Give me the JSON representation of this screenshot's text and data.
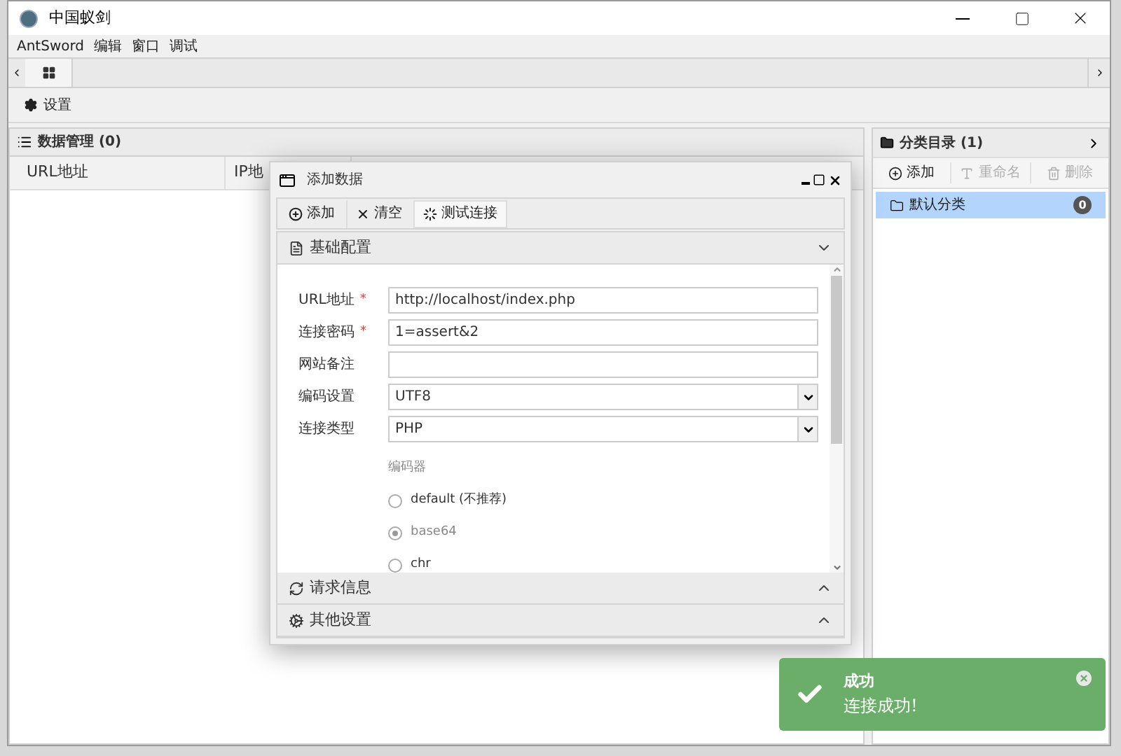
{
  "window": {
    "title": "中国蚁剑"
  },
  "menu": [
    "AntSword",
    "编辑",
    "窗口",
    "调试"
  ],
  "toolbar": {
    "settings": "设置"
  },
  "data_panel": {
    "title": "数据管理 (0)",
    "columns": [
      "URL地址",
      "IP地"
    ]
  },
  "category_panel": {
    "title": "分类目录 (1)",
    "buttons": [
      {
        "label": "添加",
        "disabled": false
      },
      {
        "label": "重命名",
        "disabled": true
      },
      {
        "label": "删除",
        "disabled": true
      }
    ],
    "items": [
      {
        "label": "默认分类",
        "count": "0",
        "selected": true
      }
    ]
  },
  "dialog": {
    "title": "添加数据",
    "buttons": [
      {
        "label": "添加",
        "selected": false
      },
      {
        "label": "清空",
        "selected": false
      },
      {
        "label": "测试连接",
        "selected": true
      }
    ],
    "sections": [
      {
        "title": "基础配置",
        "expanded": true
      },
      {
        "title": "请求信息",
        "expanded": false
      },
      {
        "title": "其他设置",
        "expanded": false
      }
    ],
    "fields": [
      {
        "kind": "text",
        "label": "URL地址",
        "required_mark": "*",
        "value": "http://localhost/index.php"
      },
      {
        "kind": "text",
        "label": "连接密码",
        "required_mark": "*",
        "value": "1=assert&2"
      },
      {
        "kind": "text",
        "label": "网站备注"
      },
      {
        "kind": "select",
        "label": "编码设置",
        "value": "UTF8"
      },
      {
        "kind": "select",
        "label": "连接类型",
        "value": "PHP"
      }
    ],
    "encoder": {
      "label": "编码器",
      "options": [
        {
          "label": "default (不推荐)",
          "selected": false
        },
        {
          "label": "base64",
          "selected": true
        },
        {
          "label": "chr",
          "selected": false
        }
      ]
    }
  },
  "toast": {
    "title": "成功",
    "message": "连接成功!"
  }
}
